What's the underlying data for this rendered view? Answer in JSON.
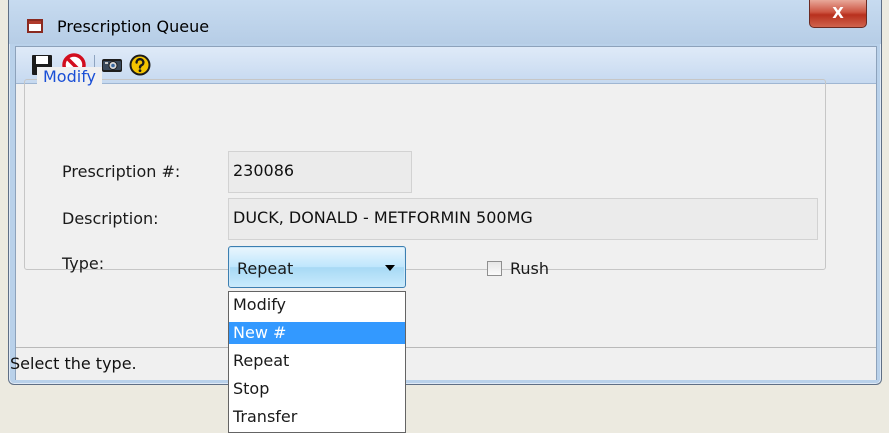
{
  "window": {
    "title": "Prescription Queue",
    "close_label": "X"
  },
  "toolbar": {
    "icons": [
      "save-icon",
      "cancel-icon",
      "camera-icon",
      "help-icon"
    ]
  },
  "form": {
    "group_legend": "Modify",
    "prescription_label": "Prescription #:",
    "prescription_value": "230086",
    "description_label": "Description:",
    "description_value": "DUCK, DONALD - METFORMIN 500MG",
    "type_label": "Type:",
    "type_value": "Repeat",
    "rush_label": "Rush"
  },
  "status_bar": {
    "text": "Select the type."
  },
  "dropdown": {
    "options": [
      "Modify",
      "New #",
      "Repeat",
      "Stop",
      "Transfer"
    ],
    "highlighted": "New #"
  },
  "colors": {
    "legend": "#1a4fd6",
    "highlight": "#3399ff",
    "close": "#c7402d"
  }
}
